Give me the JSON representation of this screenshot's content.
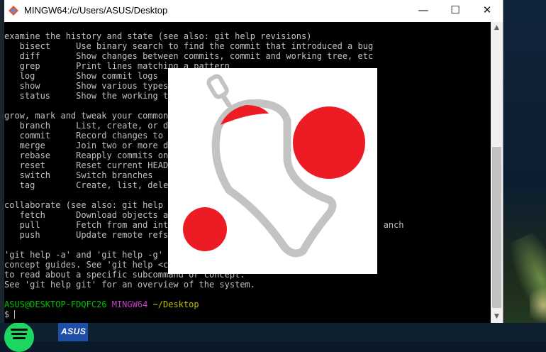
{
  "window": {
    "title": "MINGW64:/c/Users/ASUS/Desktop",
    "controls": {
      "minimize": "—",
      "maximize": "☐",
      "close": "✕"
    }
  },
  "terminal": {
    "lines": [
      "examine the history and state (see also: git help revisions)",
      "   bisect     Use binary search to find the commit that introduced a bug",
      "   diff       Show changes between commits, commit and working tree, etc",
      "   grep       Print lines matching a pattern",
      "   log        Show commit logs",
      "   show       Show various types of",
      "   status     Show the working tre",
      "",
      "grow, mark and tweak your common",
      "   branch     List, create, or del",
      "   commit     Record changes to th",
      "   merge      Join two or more dev",
      "   rebase     Reapply commits on t",
      "   reset      Reset current HEAD t",
      "   switch     Switch branches",
      "   tag        Create, list, delete",
      "",
      "collaborate (see also: git help w",
      "   fetch      Download objects and",
      "   pull       Fetch from and integ                                        anch",
      "   push       Update remote refs a",
      "",
      "'git help -a' and 'git help -g' l",
      "concept guides. See 'git help <co",
      "to read about a specific subcommand or concept.",
      "See 'git help git' for an overview of the system."
    ],
    "prompt": {
      "user_host": "ASUS@DESKTOP-FDQFC26",
      "shell": "MINGW64",
      "path": "~/Desktop",
      "input": "$ "
    }
  },
  "taskbar": {
    "asus_label": "ASUS"
  },
  "colors": {
    "terminal_bg": "#000000",
    "terminal_text": "#c0c0c0",
    "prompt_user": "#00c000",
    "prompt_shell": "#c040c0",
    "prompt_path": "#c0c000",
    "overlay_red": "#ed1c24",
    "overlay_gray": "#c3c3c3"
  },
  "icons": {
    "window_icon": "git-bash-icon",
    "overlay_drawing": "bell-drawing"
  }
}
